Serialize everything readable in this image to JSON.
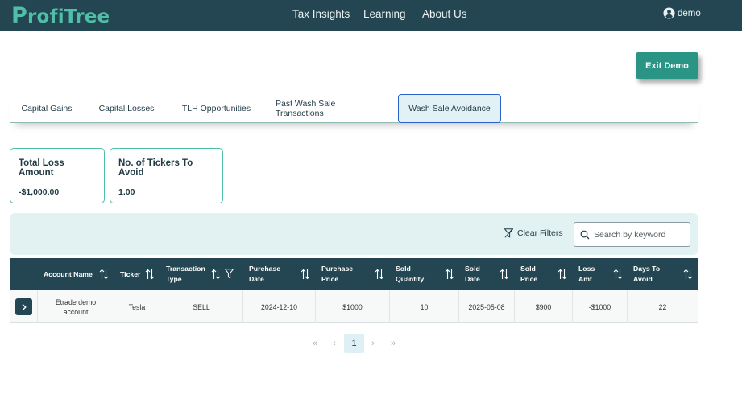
{
  "brand": {
    "logo_cap": "P",
    "logo_rest": "rofiTree"
  },
  "nav": {
    "links": [
      "Tax Insights",
      "Learning",
      "About Us"
    ],
    "user": "demo"
  },
  "exit_demo_label": "Exit Demo",
  "tabs": [
    {
      "label": "Capital Gains",
      "active": false
    },
    {
      "label": "Capital Losses",
      "active": false
    },
    {
      "label": "TLH Opportunities",
      "active": false
    },
    {
      "label": "Past Wash Sale Transactions",
      "active": false
    },
    {
      "label": "Wash Sale Avoidance",
      "active": true
    }
  ],
  "cards": [
    {
      "title": "Total Loss Amount",
      "value": "-$1,000.00"
    },
    {
      "title": "No. of Tickers To Avoid",
      "value": "1.00"
    }
  ],
  "filters": {
    "clear_label": "Clear Filters",
    "search_placeholder": "Search by keyword",
    "search_value": ""
  },
  "table": {
    "columns": [
      {
        "line1": "Account Name",
        "line2": ""
      },
      {
        "line1": "Ticker",
        "line2": ""
      },
      {
        "line1": "Transaction",
        "line2": "Type"
      },
      {
        "line1": "Purchase",
        "line2": "Date"
      },
      {
        "line1": "Purchase",
        "line2": "Price"
      },
      {
        "line1": "Sold",
        "line2": "Quantity"
      },
      {
        "line1": "Sold",
        "line2": "Date"
      },
      {
        "line1": "Sold",
        "line2": "Price"
      },
      {
        "line1": "Loss",
        "line2": "Amt"
      },
      {
        "line1": "Days To",
        "line2": "Avoid"
      }
    ],
    "rows": [
      {
        "account_line1": "Etrade demo",
        "account_line2": "account",
        "ticker": "Tesla",
        "transaction_type": "SELL",
        "purchase_date": "2024-12-10",
        "purchase_price": "$1000",
        "sold_quantity": "10",
        "sold_date": "2025-05-08",
        "sold_price": "$900",
        "loss_amt": "-$1000",
        "days_to_avoid": "22"
      }
    ]
  },
  "pagination": {
    "first": "«",
    "prev": "‹",
    "current_page": "1",
    "next": "›",
    "last": "»"
  },
  "colors": {
    "navbar": "#234652",
    "accent": "#2a9485",
    "logo": "#4fbfa8",
    "active_tab_border": "#2a62c9",
    "filter_bar_bg": "#e2f2f2"
  },
  "icons": {
    "user": "user-circle-icon",
    "sort": "sort-arrows-icon",
    "filter": "filter-icon",
    "search": "search-icon",
    "expand": "chevron-right-icon"
  }
}
